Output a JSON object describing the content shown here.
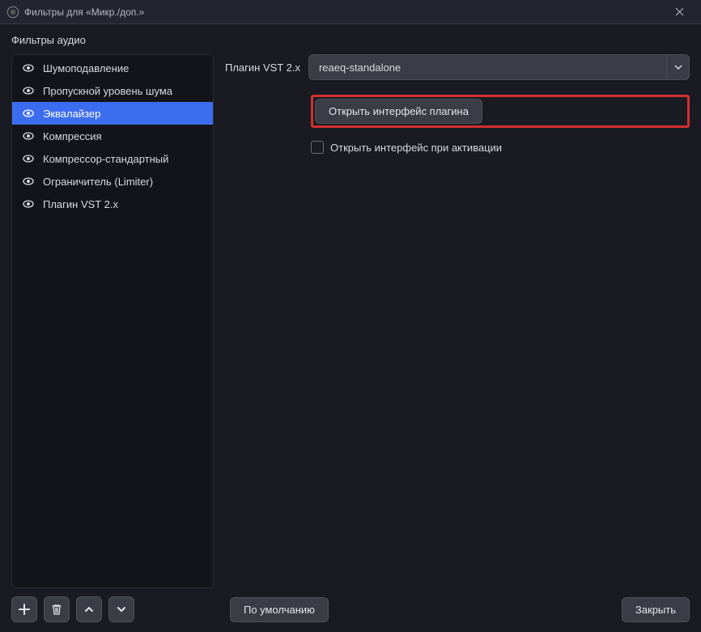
{
  "titlebar": {
    "text": "Фильтры для «Микр./доп.»"
  },
  "section_label": "Фильтры аудио",
  "filters": [
    {
      "label": "Шумоподавление",
      "selected": false
    },
    {
      "label": "Пропускной уровень шума",
      "selected": false
    },
    {
      "label": "Эквалайзер",
      "selected": true
    },
    {
      "label": "Компрессия",
      "selected": false
    },
    {
      "label": "Компрессор-стандартный",
      "selected": false
    },
    {
      "label": "Ограничитель (Limiter)",
      "selected": false
    },
    {
      "label": "Плагин VST 2.x",
      "selected": false
    }
  ],
  "main": {
    "plugin_label": "Плагин VST 2.x",
    "plugin_value": "reaeq-standalone",
    "open_interface_btn": "Открыть интерфейс плагина",
    "open_on_activate_label": "Открыть интерфейс при активации"
  },
  "footer": {
    "defaults_btn": "По умолчанию",
    "close_btn": "Закрыть"
  },
  "icons": {
    "eye": "eye-icon",
    "close_x": "close-icon",
    "plus": "plus-icon",
    "trash": "trash-icon",
    "up": "chevron-up-icon",
    "down": "chevron-down-icon",
    "caret": "caret-down-icon",
    "obs": "obs-logo-icon"
  }
}
